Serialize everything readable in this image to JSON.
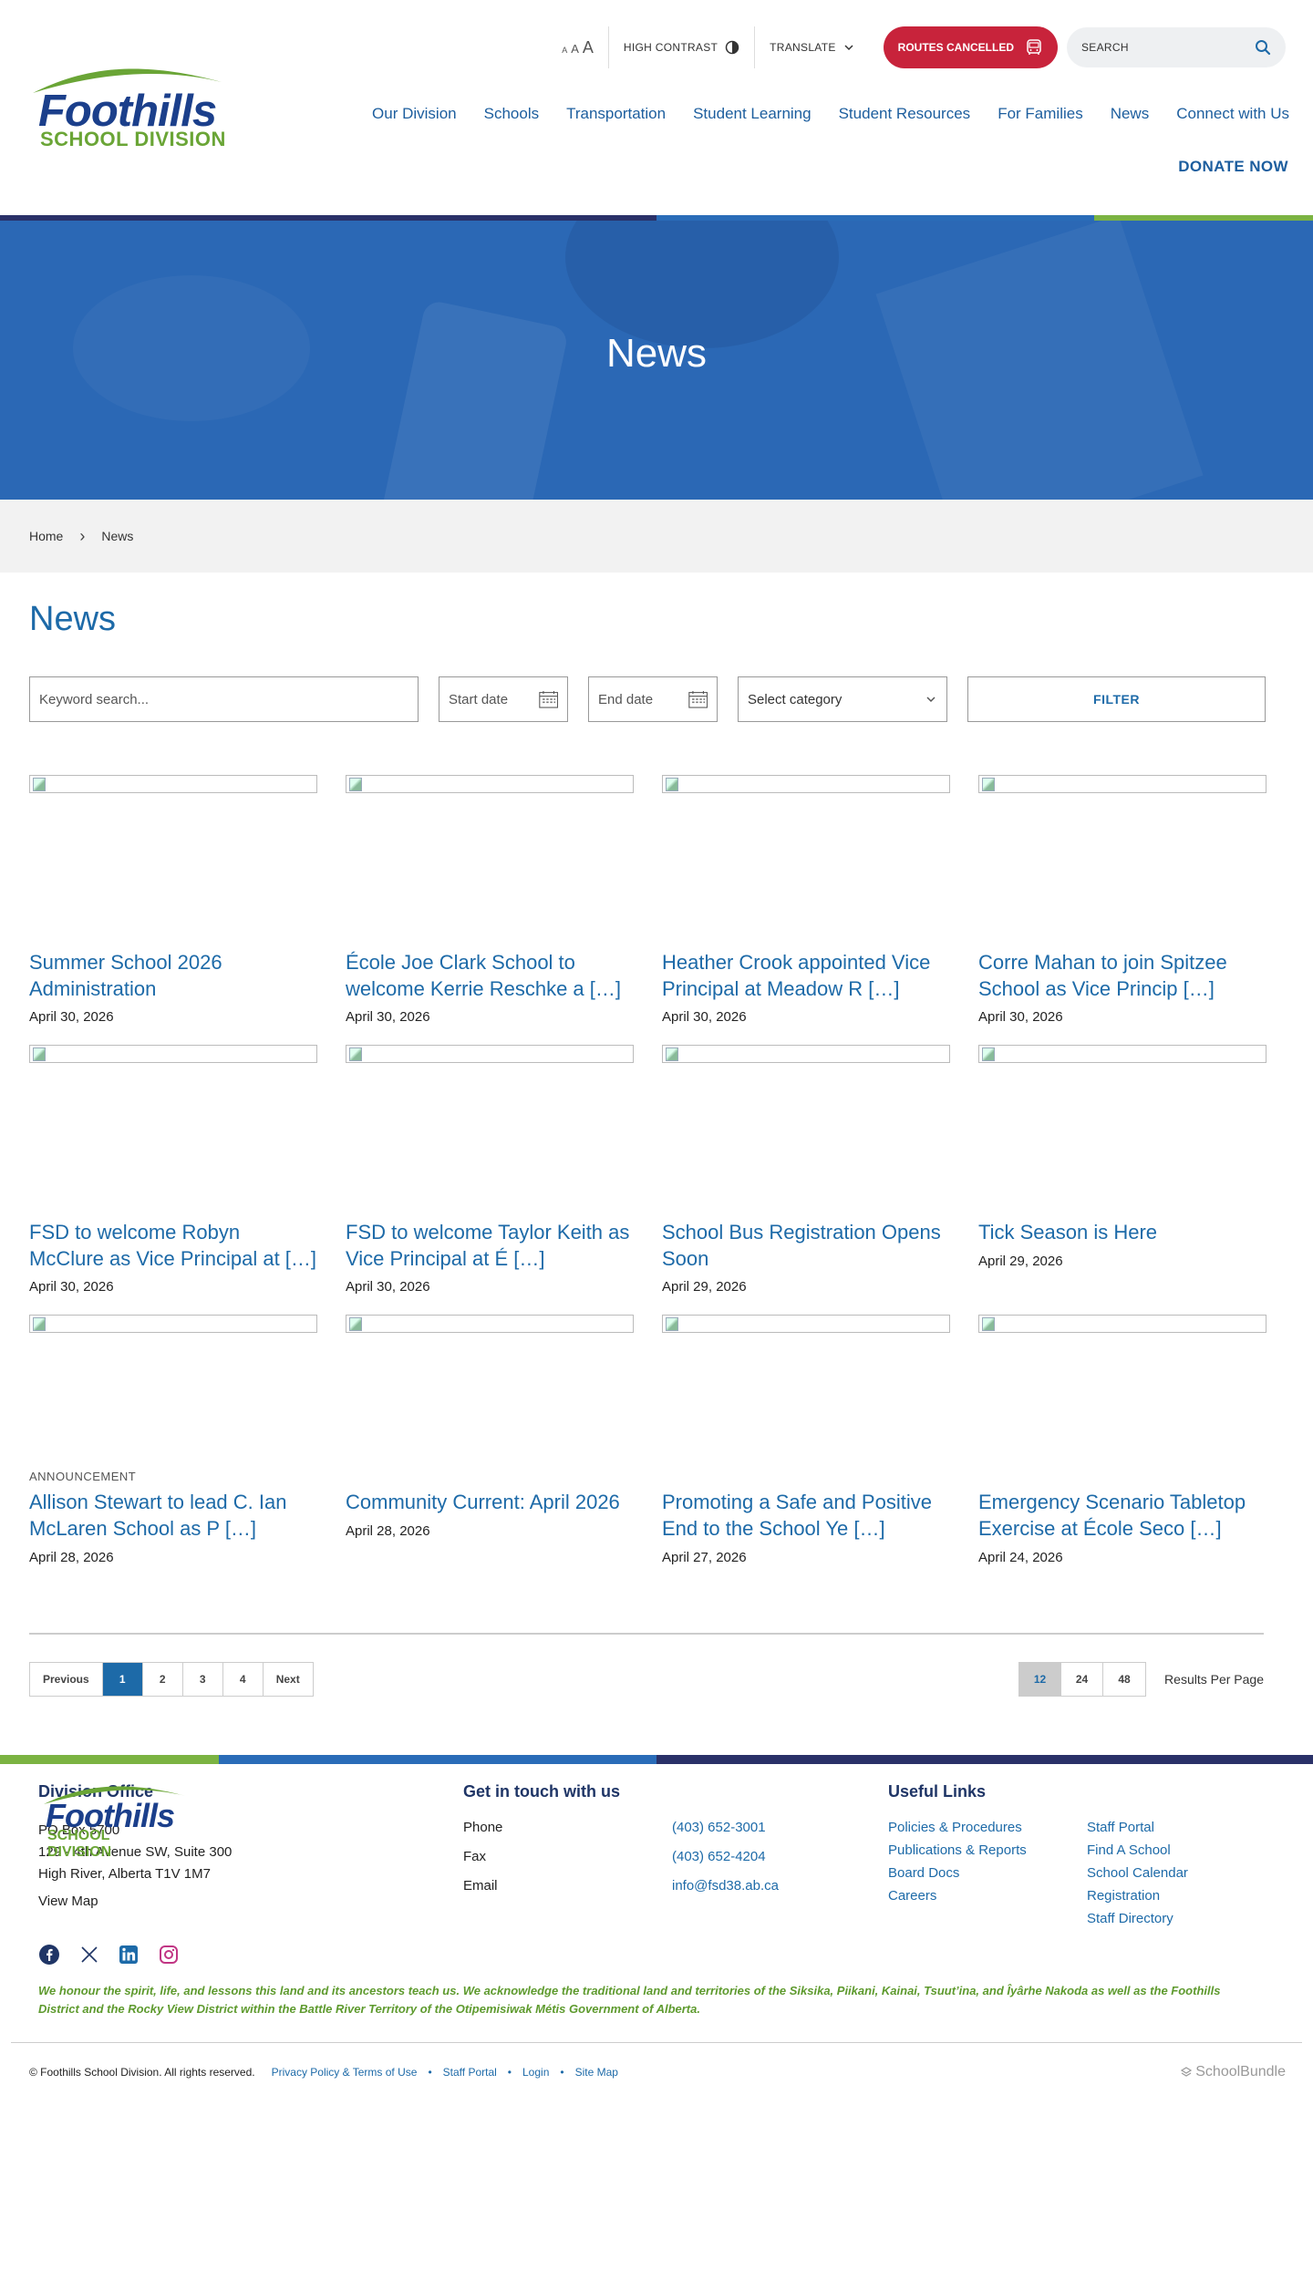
{
  "brand": {
    "logo_line1": "Foothills",
    "logo_line2": "SCHOOL DIVISION",
    "primary_color": "#1d6aa8",
    "navy_color": "#2a3168",
    "green_color": "#7bb342",
    "alert_color": "#c8233b"
  },
  "utility": {
    "text_size": [
      "A",
      "A",
      "A"
    ],
    "high_contrast": "HIGH CONTRAST",
    "translate": "TRANSLATE",
    "routes_cancelled": "ROUTES CANCELLED",
    "search_placeholder": "SEARCH"
  },
  "nav": {
    "items": [
      "Our Division",
      "Schools",
      "Transportation",
      "Student Learning",
      "Student Resources",
      "For Families",
      "News",
      "Connect with Us"
    ],
    "donate": "DONATE NOW"
  },
  "hero": {
    "title": "News"
  },
  "breadcrumb": {
    "home": "Home",
    "current": "News"
  },
  "page": {
    "title": "News",
    "filters": {
      "keyword_placeholder": "Keyword search...",
      "start_placeholder": "Start date",
      "end_placeholder": "End date",
      "category": "Select category",
      "filter_button": "FILTER"
    }
  },
  "articles": [
    {
      "tag": "",
      "title": "Summer School 2026 Administration",
      "date": "April 30, 2026"
    },
    {
      "tag": "",
      "title": "École Joe Clark School to welcome Kerrie Reschke a […]",
      "date": "April 30, 2026"
    },
    {
      "tag": "",
      "title": "Heather Crook appointed Vice Principal at Meadow R […]",
      "date": "April 30, 2026"
    },
    {
      "tag": "",
      "title": "Corre Mahan to join Spitzee School as Vice Princip […]",
      "date": "April 30, 2026"
    },
    {
      "tag": "",
      "title": "FSD to welcome Robyn McClure as Vice Principal at […]",
      "date": "April 30, 2026"
    },
    {
      "tag": "",
      "title": "FSD to welcome Taylor Keith as Vice Principal at É […]",
      "date": "April 30, 2026"
    },
    {
      "tag": "",
      "title": "School Bus Registration Opens Soon",
      "date": "April 29, 2026"
    },
    {
      "tag": "",
      "title": "Tick Season is Here",
      "date": "April 29, 2026"
    },
    {
      "tag": "ANNOUNCEMENT",
      "title": "Allison Stewart to lead C. Ian McLaren School as P […]",
      "date": "April 28, 2026"
    },
    {
      "tag": "",
      "title": "Community Current: April 2026",
      "date": "April 28, 2026"
    },
    {
      "tag": "",
      "title": "Promoting a Safe and Positive End to the School Ye […]",
      "date": "April 27, 2026"
    },
    {
      "tag": "",
      "title": "Emergency Scenario Tabletop Exercise at École Seco […]",
      "date": "April 24, 2026"
    }
  ],
  "pagination": {
    "previous": "Previous",
    "pages": [
      "1",
      "2",
      "3",
      "4"
    ],
    "current_page": "1",
    "next": "Next",
    "per_page_options": [
      "12",
      "24",
      "48"
    ],
    "per_page_selected": "12",
    "per_page_label": "Results Per Page"
  },
  "footer": {
    "office": {
      "heading": "Division Office",
      "line1": "PO Box 5700",
      "line2": "129 - 4th Avenue SW, Suite 300",
      "line3": "High River, Alberta T1V 1M7",
      "view_map": "View Map"
    },
    "contact": {
      "heading": "Get in touch with us",
      "rows": [
        {
          "label": "Phone",
          "value": "(403) 652-3001"
        },
        {
          "label": "Fax",
          "value": "(403) 652-4204"
        },
        {
          "label": "Email",
          "value": "info@fsd38.ab.ca"
        }
      ]
    },
    "links": {
      "heading": "Useful Links",
      "items": [
        "Policies & Procedures",
        "Staff Portal",
        "Publications & Reports",
        "Find A School",
        "Board Docs",
        "School Calendar",
        "Careers",
        "Registration",
        "",
        "Staff Directory"
      ]
    },
    "acknowledgement": "We honour the spirit, life, and lessons this land and its ancestors teach us. We acknowledge the traditional land and territories of the Siksika, Piikani, Kainai, Tsuut’ina, and Îyârhe Nakoda as well as the Foothills District and the Rocky View District within the Battle River Territory of the Otipemisiwak Métis Government of Alberta.",
    "copyright": "© Foothills School Division. All rights reserved.",
    "bottom_links": [
      "Privacy Policy & Terms of Use",
      "Staff Portal",
      "Login",
      "Site Map"
    ],
    "vendor": "SchoolBundle"
  }
}
